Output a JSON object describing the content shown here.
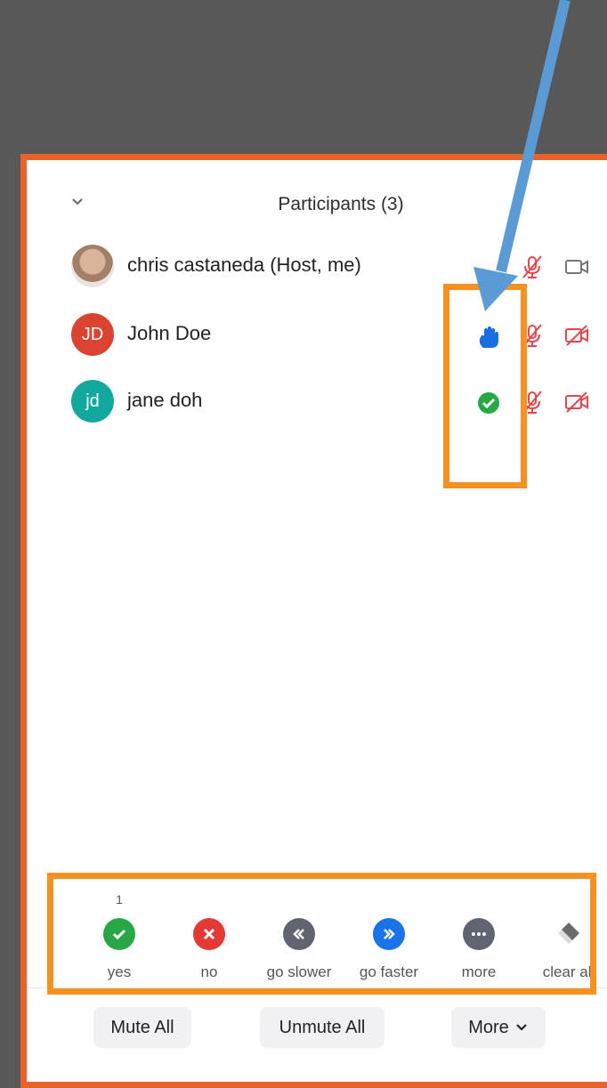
{
  "header": {
    "title": "Participants (3)"
  },
  "participants": [
    {
      "name": "chris castaneda (Host, me)",
      "initials": "",
      "avatar_type": "photo",
      "status_icon": "",
      "mic": "mic-muted-icon",
      "camera": "camera-icon"
    },
    {
      "name": "John Doe",
      "initials": "JD",
      "avatar_type": "initials",
      "avatar_color": "#d9432f",
      "status_icon": "raised-hand-icon",
      "mic": "mic-muted-icon",
      "camera": "camera-off-icon"
    },
    {
      "name": "jane doh",
      "initials": "jd",
      "avatar_type": "initials",
      "avatar_color": "#13a89e",
      "status_icon": "yes-check-icon",
      "mic": "mic-muted-icon",
      "camera": "camera-off-icon"
    }
  ],
  "reactions": [
    {
      "label": "yes",
      "count": "1",
      "color": "#28a745",
      "icon": "check-icon"
    },
    {
      "label": "no",
      "count": "",
      "color": "#e53935",
      "icon": "x-icon"
    },
    {
      "label": "go slower",
      "count": "",
      "color": "#5f6470",
      "icon": "double-chevron-left-icon"
    },
    {
      "label": "go faster",
      "count": "",
      "color": "#1a73e8",
      "icon": "double-chevron-right-icon"
    },
    {
      "label": "more",
      "count": "",
      "color": "#5f6470",
      "icon": "ellipsis-icon"
    },
    {
      "label": "clear all",
      "count": "",
      "color": "#6b6b6b",
      "icon": "eraser-icon"
    }
  ],
  "footer": {
    "mute_all": "Mute All",
    "unmute_all": "Unmute All",
    "more": "More"
  },
  "colors": {
    "panel_border": "#e8622a",
    "highlight": "#f5911e",
    "arrow": "#5b9bd5",
    "muted_red": "#e0474f",
    "hand_blue": "#1a6fe0"
  }
}
